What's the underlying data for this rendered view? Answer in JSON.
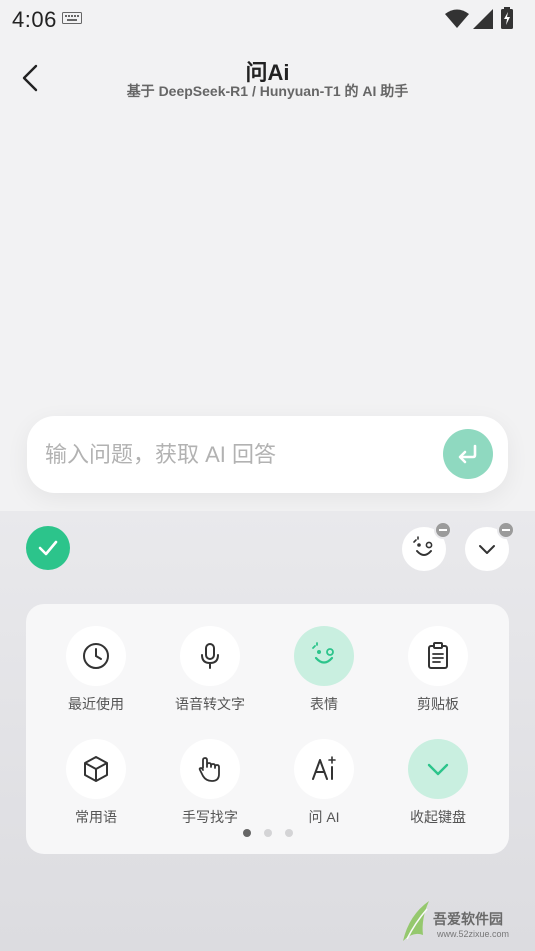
{
  "status_bar": {
    "time": "4:06",
    "icons": [
      "keyboard-icon",
      "wifi-icon",
      "signal-icon",
      "battery-icon"
    ]
  },
  "header": {
    "title": "问Ai",
    "subtitle": "基于 DeepSeek-R1 / Hunyuan-T1 的 AI 助手",
    "back_icon": "chevron-left-icon"
  },
  "input": {
    "placeholder": "输入问题，获取 AI 回答",
    "value": "",
    "send_icon": "enter-icon"
  },
  "keyboard_toolbar": {
    "confirm_icon": "check-icon",
    "right_buttons": [
      "emoji-face-icon",
      "chevron-down-icon"
    ]
  },
  "tools": [
    {
      "label": "最近使用",
      "icon": "clock-icon",
      "highlighted": false
    },
    {
      "label": "语音转文字",
      "icon": "microphone-icon",
      "highlighted": false
    },
    {
      "label": "表情",
      "icon": "emoji-face-icon",
      "highlighted": true
    },
    {
      "label": "剪贴板",
      "icon": "clipboard-icon",
      "highlighted": false
    },
    {
      "label": "常用语",
      "icon": "cube-icon",
      "highlighted": false
    },
    {
      "label": "手写找字",
      "icon": "handwriting-icon",
      "highlighted": false
    },
    {
      "label": "问 AI",
      "icon": "ai-icon",
      "highlighted": false
    },
    {
      "label": "收起键盘",
      "icon": "chevron-down-icon",
      "highlighted": true
    }
  ],
  "pagination": {
    "total": 3,
    "current": 1
  },
  "colors": {
    "accent": "#2cc48b",
    "accent_light": "#c9efe0",
    "send_button": "#8fd9c0"
  },
  "watermark": {
    "text": "吾爱软件园",
    "url": "www.52zixue.com"
  }
}
